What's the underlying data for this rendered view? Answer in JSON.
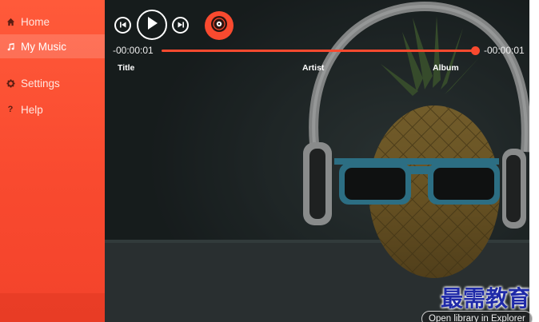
{
  "sidebar": {
    "items": [
      {
        "label": "Home",
        "icon": "home-icon",
        "active": false
      },
      {
        "label": "My Music",
        "icon": "music-note-icon",
        "active": true
      },
      {
        "label": "Settings",
        "icon": "gear-icon",
        "active": false
      },
      {
        "label": "Help",
        "icon": "question-icon",
        "active": false
      }
    ]
  },
  "player": {
    "controls": [
      "previous-icon",
      "play-icon",
      "next-icon",
      "disc-icon"
    ],
    "elapsed": "-00:00:01",
    "remaining": "-00:00:01",
    "progress": 1.0
  },
  "columns": {
    "title": "Title",
    "artist": "Artist",
    "album": "Album"
  },
  "footer": {
    "open_library": "Open library in Explorer"
  },
  "watermark": "最需教育",
  "colors": {
    "accent": "#f94a2f",
    "sidebar": "#ff5a3a",
    "main_bg": "#23292a",
    "watermark": "#1f2aa8"
  }
}
